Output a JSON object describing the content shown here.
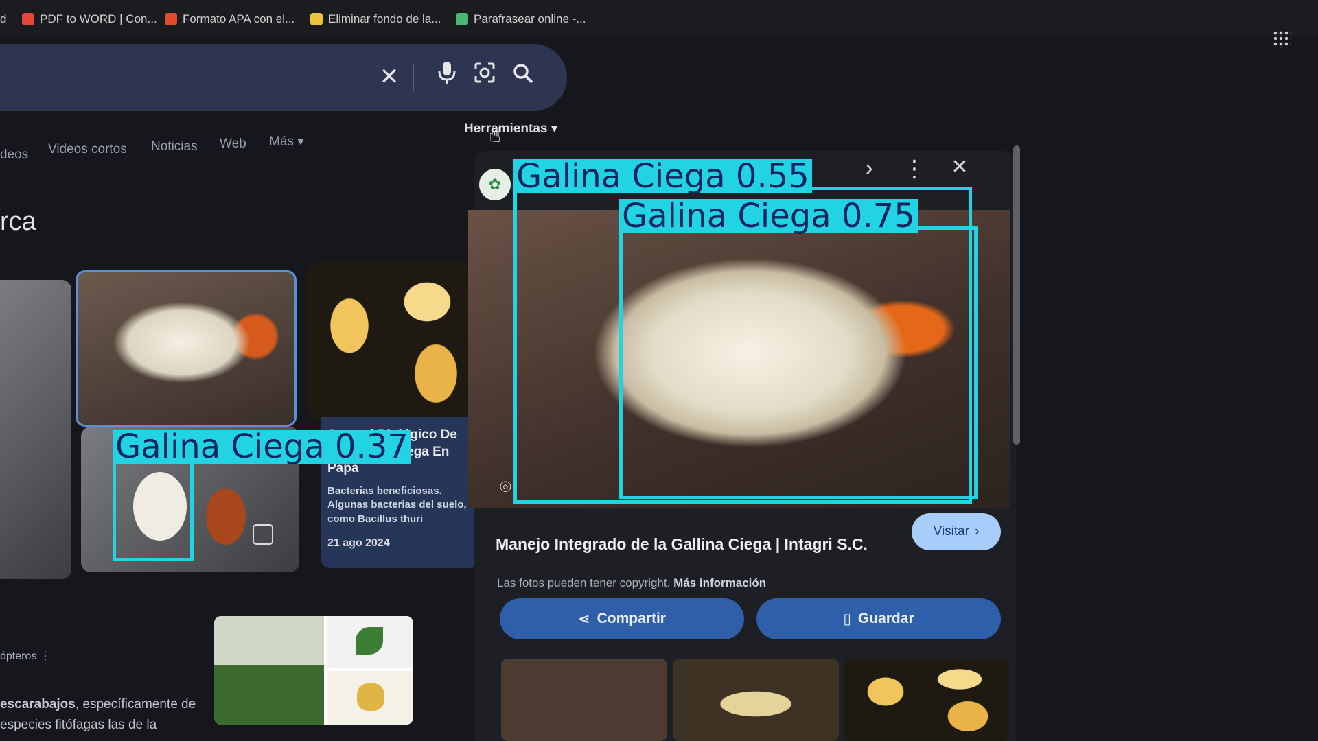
{
  "bookmarks": [
    {
      "label": "d",
      "color": ""
    },
    {
      "label": "PDF to WORD | Con...",
      "color": "#e5483a"
    },
    {
      "label": "Formato APA con el...",
      "color": "#e24c2a"
    },
    {
      "label": "Eliminar fondo de la...",
      "color": "#f0c33c"
    },
    {
      "label": "Parafrasear online -...",
      "color": "#4ab870"
    }
  ],
  "search": {
    "clear_icon": "close-icon",
    "voice_icon": "mic-icon",
    "lens_icon": "camera-lens-icon",
    "search_icon": "search-icon"
  },
  "tabs": [
    "deos",
    "Videos cortos",
    "Noticias",
    "Web",
    "Más"
  ],
  "tools_label": "Herramientas",
  "heading": "rca",
  "detail_card": {
    "title": "Control Biológico De La Gallina Ciega En Papa",
    "snippet": "Bacterias beneficiosas. Algunas bacterias del suelo, como Bacillus thuri",
    "date": "21 ago 2024"
  },
  "result": {
    "label": "ópteros",
    "snippet_bold": "escarabajos",
    "snippet": ", específicamente de especies fitófagas las de la"
  },
  "panel": {
    "title": "Manejo Integrado de la Gallina Ciega | Intagri S.C.",
    "visit": "Visitar",
    "copyright": "Las fotos pueden tener copyright.",
    "more_info": "Más información",
    "share": "Compartir",
    "save": "Guardar"
  },
  "detections": [
    {
      "label": "Galina  Ciega  0.55"
    },
    {
      "label": "Galina  Ciega  0.75"
    },
    {
      "label": "Galina  Ciega  0.37"
    }
  ],
  "colors": {
    "detection": "#22d3e3",
    "detection_text": "#10245e",
    "accent": "#2e5fa8",
    "visit_button": "#a9cdfa"
  }
}
